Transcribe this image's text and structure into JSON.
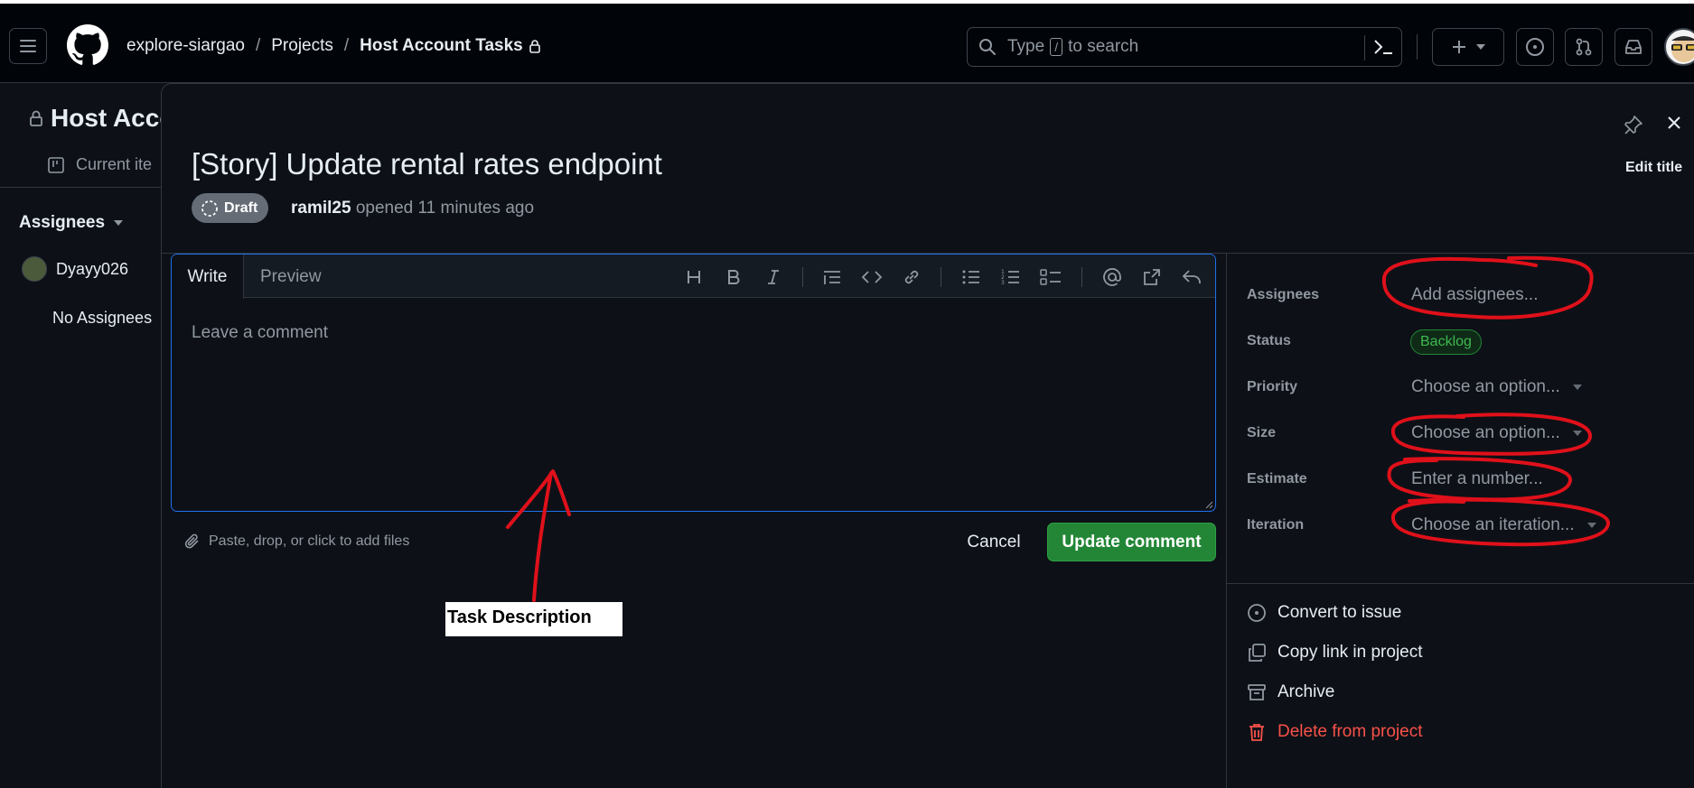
{
  "header": {
    "breadcrumb": [
      "explore-siargao",
      "Projects",
      "Host Account Tasks"
    ],
    "search_prefix": "Type",
    "search_key": "/",
    "search_suffix": "to search"
  },
  "background_page": {
    "title": "Host Acco",
    "view_tab": "Current ite",
    "group_label": "Assignees",
    "user": "Dyayy026",
    "no_assignees": "No Assignees"
  },
  "item": {
    "title": "[Story] Update rental rates endpoint",
    "state": "Draft",
    "author": "ramil25",
    "opened": "opened 11 minutes ago",
    "edit_title": "Edit title"
  },
  "editor": {
    "tab_write": "Write",
    "tab_preview": "Preview",
    "placeholder": "Leave a comment",
    "attach_hint": "Paste, drop, or click to add files",
    "cancel": "Cancel",
    "submit": "Update comment"
  },
  "fields": {
    "assignees_label": "Assignees",
    "assignees_value": "Add assignees...",
    "status_label": "Status",
    "status_value": "Backlog",
    "priority_label": "Priority",
    "priority_value": "Choose an option...",
    "size_label": "Size",
    "size_value": "Choose an option...",
    "estimate_label": "Estimate",
    "estimate_value": "Enter a number...",
    "iteration_label": "Iteration",
    "iteration_value": "Choose an iteration..."
  },
  "actions": {
    "convert": "Convert to issue",
    "copy_link": "Copy link in project",
    "archive": "Archive",
    "delete": "Delete from project"
  },
  "annotation": {
    "label": "Task Description"
  },
  "colors": {
    "accent_blue": "#1f6feb",
    "primary_green": "#238636",
    "danger_red": "#f85149",
    "annotation_red": "#e0101a"
  }
}
